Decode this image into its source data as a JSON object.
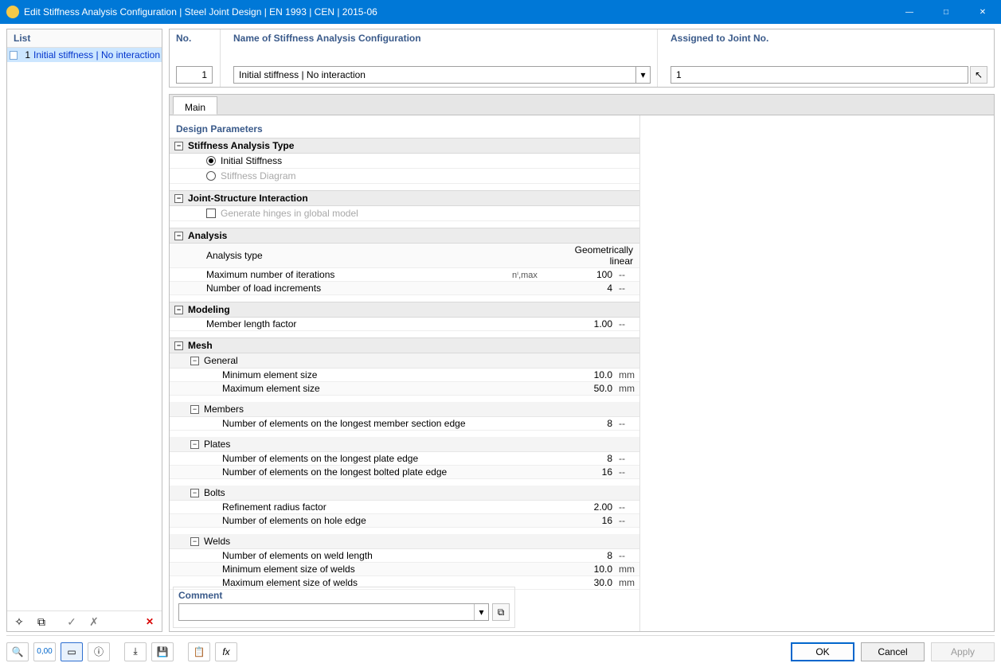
{
  "window": {
    "title": "Edit Stiffness Analysis Configuration | Steel Joint Design | EN 1993 | CEN | 2015-06"
  },
  "left": {
    "header": "List",
    "items": [
      {
        "no": "1",
        "label": "Initial stiffness | No interaction"
      }
    ]
  },
  "top": {
    "no_label": "No.",
    "no_value": "1",
    "name_label": "Name of Stiffness Analysis Configuration",
    "name_value": "Initial stiffness | No interaction",
    "assigned_label": "Assigned to Joint No.",
    "assigned_value": "1"
  },
  "tabs": {
    "main": "Main"
  },
  "main": {
    "design_params_header": "Design Parameters",
    "groups": {
      "stiffness_type": {
        "title": "Stiffness Analysis Type",
        "opt_initial": "Initial Stiffness",
        "opt_diagram": "Stiffness Diagram",
        "selected": "initial"
      },
      "interaction": {
        "title": "Joint-Structure Interaction",
        "gen_hinges": "Generate hinges in global model",
        "gen_hinges_checked": false
      },
      "analysis": {
        "title": "Analysis",
        "type_label": "Analysis type",
        "type_value": "Geometrically linear",
        "max_iter_label": "Maximum number of iterations",
        "max_iter_sym": "nⁱ,max",
        "max_iter_value": "100",
        "max_iter_unit": "--",
        "load_inc_label": "Number of load increments",
        "load_inc_value": "4",
        "load_inc_unit": "--"
      },
      "modeling": {
        "title": "Modeling",
        "mlf_label": "Member length factor",
        "mlf_value": "1.00",
        "mlf_unit": "--"
      },
      "mesh": {
        "title": "Mesh",
        "general": {
          "title": "General",
          "min_label": "Minimum element size",
          "min_value": "10.0",
          "min_unit": "mm",
          "max_label": "Maximum element size",
          "max_value": "50.0",
          "max_unit": "mm"
        },
        "members": {
          "title": "Members",
          "nels_label": "Number of elements on the longest member section edge",
          "nels_value": "8",
          "nels_unit": "--"
        },
        "plates": {
          "title": "Plates",
          "nplate_label": "Number of elements on the longest plate edge",
          "nplate_value": "8",
          "nplate_unit": "--",
          "nbolted_label": "Number of elements on the longest bolted plate edge",
          "nbolted_value": "16",
          "nbolted_unit": "--"
        },
        "bolts": {
          "title": "Bolts",
          "refine_label": "Refinement radius factor",
          "refine_value": "2.00",
          "refine_unit": "--",
          "nhole_label": "Number of elements on hole edge",
          "nhole_value": "16",
          "nhole_unit": "--"
        },
        "welds": {
          "title": "Welds",
          "nweld_label": "Number of elements on weld length",
          "nweld_value": "8",
          "nweld_unit": "--",
          "wmin_label": "Minimum element size of welds",
          "wmin_value": "10.0",
          "wmin_unit": "mm",
          "wmax_label": "Maximum element size of welds",
          "wmax_value": "30.0",
          "wmax_unit": "mm"
        }
      }
    },
    "comment_header": "Comment",
    "comment_value": ""
  },
  "footer": {
    "ok": "OK",
    "cancel": "Cancel",
    "apply": "Apply"
  }
}
